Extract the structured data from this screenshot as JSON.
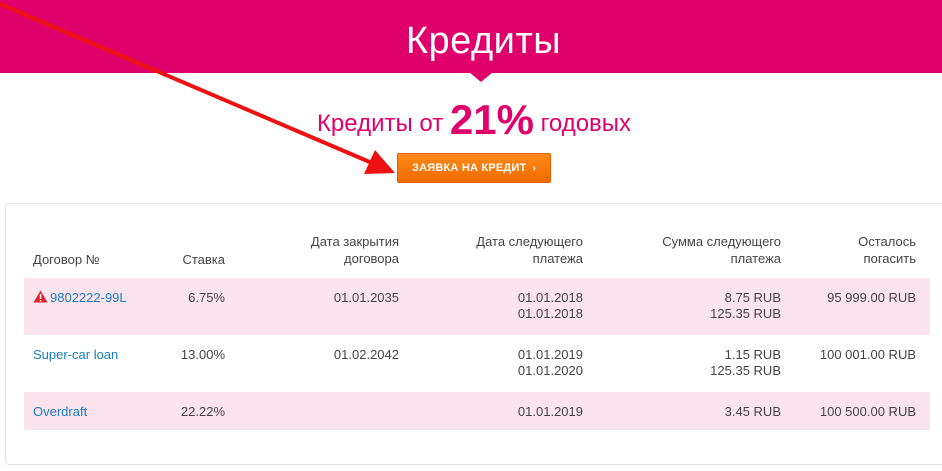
{
  "header": {
    "title": "Кредиты"
  },
  "promo": {
    "prefix": "Кредиты от",
    "rate": "21%",
    "suffix": "годовых"
  },
  "apply_button": {
    "label": "ЗАЯВКА НА КРЕДИТ",
    "chevron": "›"
  },
  "table": {
    "columns": {
      "contract": "Договор №",
      "rate": "Ставка",
      "close_date_l1": "Дата закрытия",
      "close_date_l2": "договора",
      "next_date_l1": "Дата следующего",
      "next_date_l2": "платежа",
      "next_amount_l1": "Сумма следующего",
      "next_amount_l2": "платежа",
      "remaining_l1": "Осталось",
      "remaining_l2": "погасить"
    },
    "rows": [
      {
        "contract": "9802222-99L",
        "warning": true,
        "rate": "6.75%",
        "close_date": "01.01.2035",
        "next_dates": [
          "01.01.2018",
          "01.01.2018"
        ],
        "next_amounts": [
          "8.75 RUB",
          "125.35 RUB"
        ],
        "remaining": "95 999.00 RUB"
      },
      {
        "contract": "Super-car loan",
        "warning": false,
        "rate": "13.00%",
        "close_date": "01.02.2042",
        "next_dates": [
          "01.01.2019",
          "01.01.2020"
        ],
        "next_amounts": [
          "1.15 RUB",
          "125.35 RUB"
        ],
        "remaining": "100 001.00 RUB"
      },
      {
        "contract": "Overdraft",
        "warning": false,
        "rate": "22.22%",
        "close_date": "",
        "next_dates": [
          "01.01.2019"
        ],
        "next_amounts": [
          "3.45 RUB"
        ],
        "remaining": "100 500.00 RUB"
      }
    ]
  },
  "colors": {
    "brand": "#e0006b",
    "button": "#f47a0c",
    "link": "#1a7bc4",
    "row_highlight": "#fce4ee",
    "arrow": "#ee1111"
  },
  "icons": {
    "warning": "warning-triangle-icon",
    "annotation": "red-arrow-annotation"
  }
}
